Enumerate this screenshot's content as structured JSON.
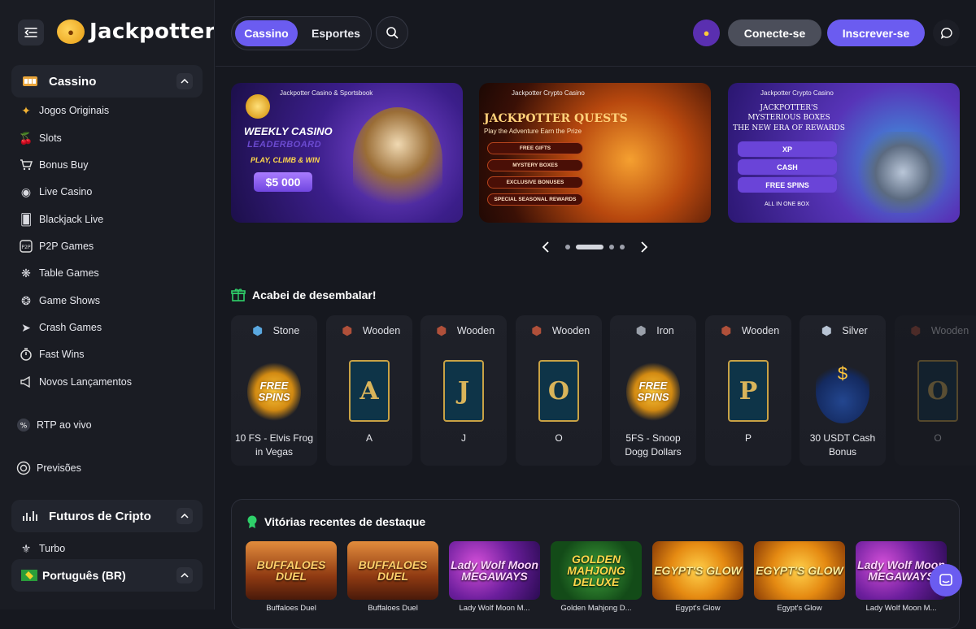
{
  "brand": {
    "name": "Jackpotter"
  },
  "sidebar": {
    "casino_label": "Cassino",
    "items": [
      {
        "label": "Jogos Originais",
        "icon": "originals-icon"
      },
      {
        "label": "Slots",
        "icon": "slots-icon"
      },
      {
        "label": "Bonus Buy",
        "icon": "cart-icon"
      },
      {
        "label": "Live Casino",
        "icon": "live-icon"
      },
      {
        "label": "Blackjack Live",
        "icon": "cards-icon"
      },
      {
        "label": "P2P Games",
        "icon": "p2p-icon"
      },
      {
        "label": "Table Games",
        "icon": "table-icon"
      },
      {
        "label": "Game Shows",
        "icon": "wheel-icon"
      },
      {
        "label": "Crash Games",
        "icon": "rocket-icon"
      },
      {
        "label": "Fast Wins",
        "icon": "stopwatch-icon"
      },
      {
        "label": "Novos Lançamentos",
        "icon": "megaphone-icon"
      }
    ],
    "rtp_label": "RTP ao vivo",
    "predictions_label": "Previsões",
    "futures_label": "Futuros de Cripto",
    "turbo_label": "Turbo",
    "language_label": "Português (BR)"
  },
  "header": {
    "tabs": [
      "Cassino",
      "Esportes"
    ],
    "login_label": "Conecte-se",
    "signup_label": "Inscrever-se"
  },
  "banners": {
    "b1": {
      "brand": "Jackpotter Casino & Sportsbook",
      "line1": "WEEKLY CASINO",
      "line2": "LEADERBOARD",
      "line3": "PLAY, CLIMB & WIN",
      "prize": "$5 000"
    },
    "b2": {
      "brand": "Jackpotter Crypto Casino",
      "title": "JACKPOTTER QUESTS",
      "subtitle": "Play the Adventure   Earn the Prize",
      "pills": [
        "FREE GIFTS",
        "MYSTERY BOXES",
        "EXCLUSIVE BONUSES",
        "SPECIAL SEASONAL REWARDS"
      ]
    },
    "b3": {
      "brand": "Jackpotter Crypto Casino",
      "title1": "JACKPOTTER'S",
      "title2": "MYSTERIOUS BOXES",
      "title3": "THE NEW ERA OF REWARDS",
      "pills": [
        "XP",
        "CASH",
        "FREE SPINS"
      ],
      "footer": "ALL IN ONE BOX"
    }
  },
  "unboxed": {
    "title": "Acabei de desembalar!",
    "cards": [
      {
        "tier": "Stone",
        "label": "10 FS - Elvis Frog in Vegas",
        "kind": "freespins",
        "art": "FREE SPINS"
      },
      {
        "tier": "Wooden",
        "label": "A",
        "kind": "tarot",
        "art": "A"
      },
      {
        "tier": "Wooden",
        "label": "J",
        "kind": "tarot",
        "art": "J"
      },
      {
        "tier": "Wooden",
        "label": "O",
        "kind": "tarot",
        "art": "O"
      },
      {
        "tier": "Iron",
        "label": "5FS - Snoop Dogg Dollars",
        "kind": "freespins",
        "art": "FREE SPINS"
      },
      {
        "tier": "Wooden",
        "label": "P",
        "kind": "tarot",
        "art": "P"
      },
      {
        "tier": "Silver",
        "label": "30 USDT Cash Bonus",
        "kind": "cash",
        "art": "$"
      },
      {
        "tier": "Wooden",
        "label": "O",
        "kind": "tarot",
        "art": "O"
      }
    ]
  },
  "recent_wins": {
    "title": "Vitórias recentes de destaque",
    "games": [
      {
        "name": "Buffaloes Duel",
        "art": "BUFFALOES DUEL",
        "style": "g-buff"
      },
      {
        "name": "Buffaloes Duel",
        "art": "BUFFALOES DUEL",
        "style": "g-buff"
      },
      {
        "name": "Lady Wolf Moon M...",
        "art": "Lady Wolf Moon MEGAWAYS",
        "style": "g-lady"
      },
      {
        "name": "Golden Mahjong D...",
        "art": "GOLDEN MAHJONG DELUXE",
        "style": "g-gold"
      },
      {
        "name": "Egypt's Glow",
        "art": "EGYPT'S GLOW",
        "style": "g-egypt"
      },
      {
        "name": "Egypt's Glow",
        "art": "EGYPT'S GLOW",
        "style": "g-egypt"
      },
      {
        "name": "Lady Wolf Moon M...",
        "art": "Lady Wolf Moon MEGAWAYS",
        "style": "g-lady"
      }
    ]
  },
  "colors": {
    "accent": "#6b5cf0",
    "bg": "#16181f",
    "sidebar": "#1a1c23"
  }
}
